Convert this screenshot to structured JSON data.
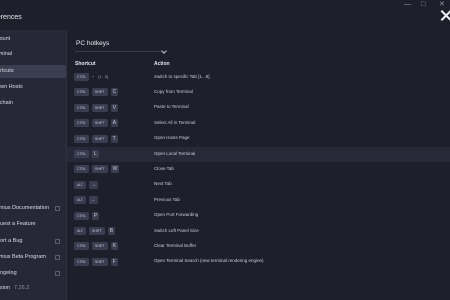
{
  "window": {
    "title": "eferences",
    "controls": [
      "—",
      "□",
      "✕"
    ]
  },
  "sidebar": {
    "items": [
      {
        "label": "ccount",
        "active": false,
        "external": false
      },
      {
        "label": "erminal",
        "active": false,
        "external": false
      },
      {
        "label": "hortcuts",
        "active": true,
        "external": false
      },
      {
        "label": "nown Hosts",
        "active": false,
        "external": false
      },
      {
        "label": "eychain",
        "active": false,
        "external": false
      },
      {
        "label": "ermius Documentation",
        "active": false,
        "external": true
      },
      {
        "label": "equest a Feature",
        "active": false,
        "external": false
      },
      {
        "label": "eport a Bug",
        "active": false,
        "external": true
      },
      {
        "label": "ermius Beta Program",
        "active": false,
        "external": true
      },
      {
        "label": "hangelog",
        "active": false,
        "external": true
      }
    ],
    "version_label": "ersion",
    "version_number": "7.26.2"
  },
  "main": {
    "preset_select": "PC hotkeys",
    "columns": {
      "shortcut": "Shortcut",
      "action": "Action"
    },
    "rows": [
      {
        "keys": [
          "CTRL"
        ],
        "extra": [
          "+",
          "[1...9]"
        ],
        "action": "Switch to specific Tab [1...9]",
        "highlight": false
      },
      {
        "keys": [
          "CTRL",
          "SHIFT",
          "C"
        ],
        "action": "Copy from Terminal",
        "highlight": false
      },
      {
        "keys": [
          "CTRL",
          "SHIFT",
          "V"
        ],
        "action": "Paste to Terminal",
        "highlight": false
      },
      {
        "keys": [
          "CTRL",
          "SHIFT",
          "A"
        ],
        "action": "Select All in Terminal",
        "highlight": false
      },
      {
        "keys": [
          "CTRL",
          "SHIFT",
          "T"
        ],
        "action": "Open Hosts Page",
        "highlight": false
      },
      {
        "keys": [
          "CTRL",
          "L"
        ],
        "action": "Open Local Terminal",
        "highlight": true
      },
      {
        "keys": [
          "CTRL",
          "SHIFT",
          "W"
        ],
        "action": "Close Tab",
        "highlight": false
      },
      {
        "keys": [
          "ALT",
          "→"
        ],
        "action": "Next Tab",
        "highlight": false
      },
      {
        "keys": [
          "ALT",
          "←"
        ],
        "action": "Previous Tab",
        "highlight": false
      },
      {
        "keys": [
          "CTRL",
          "P"
        ],
        "action": "Open Port Forwarding",
        "highlight": false
      },
      {
        "keys": [
          "ALT",
          "SHIFT",
          "B"
        ],
        "action": "Switch Left Panel Size",
        "highlight": false
      },
      {
        "keys": [
          "CTRL",
          "SHIFT",
          "K"
        ],
        "action": "Clear Terminal Buffer",
        "highlight": false
      },
      {
        "keys": [
          "CTRL",
          "SHIFT",
          "F"
        ],
        "action": "Open Terminal Search (new terminal rendering engine)",
        "highlight": false
      }
    ]
  },
  "colors": {
    "background": "#1d1f2b",
    "sidebar": "#262837",
    "active": "#3b3e51",
    "key": "#3a3d50"
  }
}
